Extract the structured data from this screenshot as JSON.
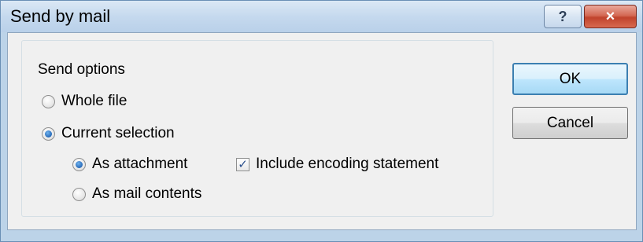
{
  "window": {
    "title": "Send by mail",
    "help_button": "?",
    "close_button": "×"
  },
  "send_options": {
    "group_label": "Send options",
    "whole_file": {
      "label": "Whole file",
      "checked": false
    },
    "current_selection": {
      "label": "Current selection",
      "checked": true
    },
    "as_attachment": {
      "label": "As attachment",
      "checked": true
    },
    "as_mail_contents": {
      "label": "As mail contents",
      "checked": false
    },
    "include_encoding": {
      "label": "Include encoding statement",
      "checked": true
    }
  },
  "buttons": {
    "ok": "OK",
    "cancel": "Cancel"
  }
}
